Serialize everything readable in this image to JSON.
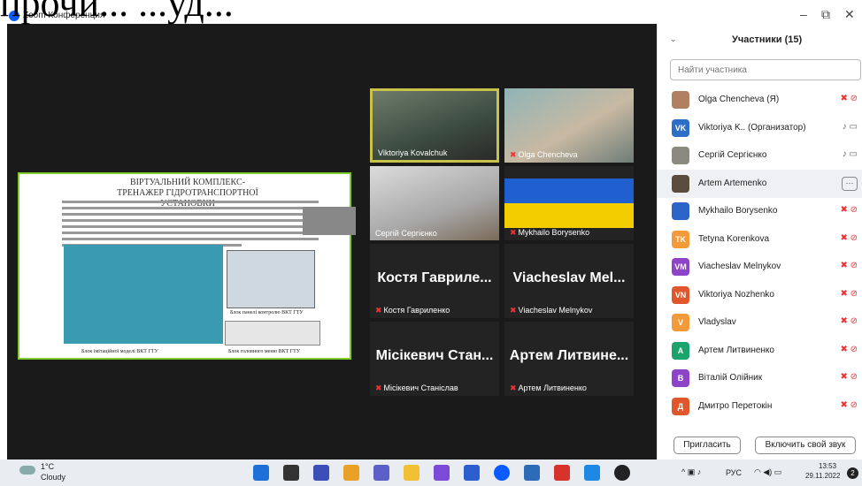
{
  "cover_text": "прочи... ...уд...",
  "app": {
    "title": "Zoom Конференция"
  },
  "window": {
    "minimize": "–",
    "restore": "⧉",
    "close": "✕"
  },
  "slide": {
    "title": "ВІРТУАЛЬНИЙ КОМПЛЕКС-ТРЕНАЖЕР ГІДРОТРАНСПОРТНОЇ УСТАНОВКИ",
    "caption_panel": "Блок панелі контролю ВКТ ГТУ",
    "caption_model": "Блок імітаційної моделі ВКТ ГТУ",
    "caption_menu": "Блок головного меню ВКТ ГТУ"
  },
  "tiles": [
    {
      "name": "Viktoriya Kovalchuk",
      "muted": false,
      "video": true,
      "active": true
    },
    {
      "name": "Olga Chencheva",
      "muted": true,
      "video": true,
      "active": false
    },
    {
      "name": "Сергій Сергієнко",
      "muted": false,
      "video": true,
      "active": false
    },
    {
      "name": "Mykhailo Borysenko",
      "muted": true,
      "video": true,
      "active": false
    },
    {
      "name": "Костя Гавриленко",
      "big": "Костя Гавриле...",
      "muted": true,
      "video": false,
      "active": false
    },
    {
      "name": "Viacheslav Melnykov",
      "big": "Viacheslav Mel...",
      "muted": true,
      "video": false,
      "active": false
    },
    {
      "name": "Місікевич Станіслав",
      "big": "Місікевич Стан...",
      "muted": true,
      "video": false,
      "active": false
    },
    {
      "name": "Артем Литвиненко",
      "big": "Артем Литвине...",
      "muted": true,
      "video": false,
      "active": false
    }
  ],
  "panel": {
    "title": "Участники (15)",
    "search_placeholder": "Найти участника",
    "participants": [
      {
        "name": "Olga Chencheva (Я)",
        "initials": "",
        "color": "#b08060",
        "muted": true
      },
      {
        "name": "Viktoriya K..  (Организатор)",
        "initials": "VK",
        "color": "#2d6fc7",
        "muted": false
      },
      {
        "name": "Сергій Сергієнко",
        "initials": "",
        "color": "#8a8a80",
        "muted": false
      },
      {
        "name": "Artem Artemenko",
        "initials": "",
        "color": "#5b4b3d",
        "muted": false
      },
      {
        "name": "Mykhailo Borysenko",
        "initials": "",
        "color": "#2c64c8",
        "muted": true
      },
      {
        "name": "Tetyna Korenkova",
        "initials": "TK",
        "color": "#f39a3a",
        "muted": true
      },
      {
        "name": "Viacheslav Melnykov",
        "initials": "VM",
        "color": "#8e44c9",
        "muted": true
      },
      {
        "name": "Viktoriya Nozhenko",
        "initials": "VN",
        "color": "#e0572b",
        "muted": true
      },
      {
        "name": "Vladyslav",
        "initials": "V",
        "color": "#f39a3a",
        "muted": true
      },
      {
        "name": "Артем Литвиненко",
        "initials": "А",
        "color": "#1aa36b",
        "muted": true
      },
      {
        "name": "Віталій Олійник",
        "initials": "В",
        "color": "#8e44c9",
        "muted": true
      },
      {
        "name": "Дмитро Перетокін",
        "initials": "Д",
        "color": "#e0572b",
        "muted": true
      }
    ],
    "invite_label": "Пригласить",
    "unmute_label": "Включить свой звук"
  },
  "taskbar": {
    "weather_temp": "1°C",
    "weather_desc": "Cloudy",
    "lang": "РУС",
    "time": "13:53",
    "date": "29.11.2022",
    "notifications": "2"
  }
}
